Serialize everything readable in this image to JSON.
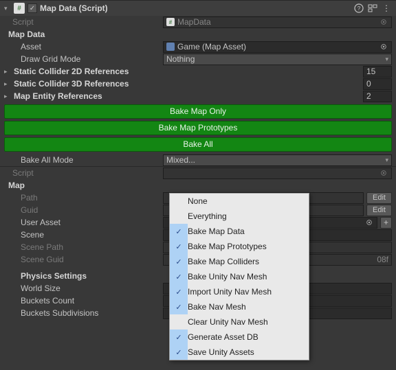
{
  "component1": {
    "title": "Map Data (Script)",
    "enabled": true,
    "scriptLabel": "Script",
    "scriptValue": "MapData",
    "sectionHead": "Map Data",
    "assetLabel": "Asset",
    "assetValue": "Game (Map Asset)",
    "drawGridLabel": "Draw Grid Mode",
    "drawGridValue": "Nothing",
    "static2dLabel": "Static Collider 2D References",
    "static2dCount": "15",
    "static3dLabel": "Static Collider 3D References",
    "static3dCount": "0",
    "entityLabel": "Map Entity References",
    "entityCount": "2",
    "btnBakeMap": "Bake Map Only",
    "btnBakeProto": "Bake Map Prototypes",
    "btnBakeAll": "Bake All",
    "bakeAllModeLabel": "Bake All Mode",
    "bakeAllModeValue": "Mixed..."
  },
  "component2": {
    "scriptLabel": "Script",
    "scriptValue": "",
    "sectionHead": "Map",
    "pathLabel": "Path",
    "guidLabel": "Guid",
    "userAssetLabel": "User Asset",
    "sceneLabel": "Scene",
    "scenePathLabel": "Scene Path",
    "sceneGuidLabel": "Scene Guid",
    "sceneGuidValueTail": "08f",
    "editBtn": "Edit",
    "addBtn": "+",
    "physicsHead": "Physics Settings",
    "worldSizeLabel": "World Size",
    "bucketsCountLabel": "Buckets Count",
    "bucketsSubLabel": "Buckets Subdivisions"
  },
  "popup": {
    "items": [
      {
        "label": "None",
        "checked": false
      },
      {
        "label": "Everything",
        "checked": false
      },
      {
        "label": "Bake Map Data",
        "checked": true
      },
      {
        "label": "Bake Map Prototypes",
        "checked": true
      },
      {
        "label": "Bake Map Colliders",
        "checked": true
      },
      {
        "label": "Bake Unity Nav Mesh",
        "checked": true
      },
      {
        "label": "Import Unity Nav Mesh",
        "checked": true
      },
      {
        "label": "Bake Nav Mesh",
        "checked": true
      },
      {
        "label": "Clear Unity Nav Mesh",
        "checked": false
      },
      {
        "label": "Generate Asset DB",
        "checked": true
      },
      {
        "label": "Save Unity Assets",
        "checked": true
      }
    ]
  }
}
